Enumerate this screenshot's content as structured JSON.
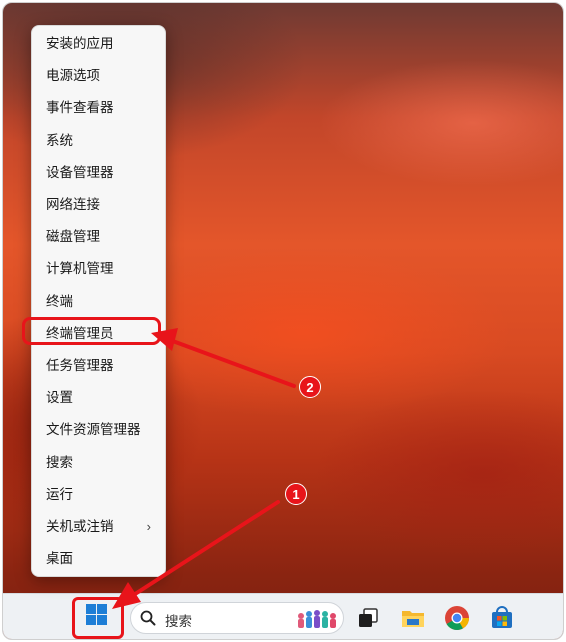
{
  "context_menu": {
    "items": [
      {
        "label": "安装的应用"
      },
      {
        "label": "电源选项"
      },
      {
        "label": "事件查看器"
      },
      {
        "label": "系统"
      },
      {
        "label": "设备管理器"
      },
      {
        "label": "网络连接"
      },
      {
        "label": "磁盘管理"
      },
      {
        "label": "计算机管理"
      },
      {
        "label": "终端"
      },
      {
        "label": "终端管理员"
      },
      {
        "label": "任务管理器"
      },
      {
        "label": "设置"
      },
      {
        "label": "文件资源管理器"
      },
      {
        "label": "搜索"
      },
      {
        "label": "运行"
      },
      {
        "label": "关机或注销",
        "submenu": true
      },
      {
        "label": "桌面"
      }
    ],
    "submenu_glyph": "›"
  },
  "taskbar": {
    "search_label": "搜索",
    "icons": [
      "windows-start-icon",
      "search-icon",
      "task-view-icon",
      "file-explorer-icon",
      "chrome-icon",
      "microsoft-store-icon"
    ]
  },
  "annotations": {
    "badge_1": "1",
    "badge_2": "2",
    "color": "#e8141a"
  }
}
